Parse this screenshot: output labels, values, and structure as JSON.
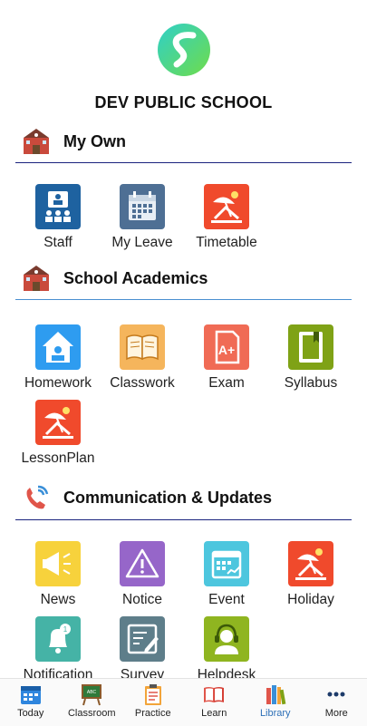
{
  "school": {
    "name": "DEV PUBLIC SCHOOL"
  },
  "sections": [
    {
      "title": "My Own",
      "icon": "school-building-icon",
      "items": [
        {
          "label": "Staff",
          "icon": "staff-icon",
          "color": "#1e62a0"
        },
        {
          "label": "My Leave",
          "icon": "calendar-icon",
          "color": "#4e6f94"
        },
        {
          "label": "Timetable",
          "icon": "beach-chair-icon",
          "color": "#f04a2c"
        }
      ]
    },
    {
      "title": "School Academics",
      "icon": "school-building-icon",
      "items": [
        {
          "label": "Homework",
          "icon": "home-study-icon",
          "color": "#2e9cf0"
        },
        {
          "label": "Classwork",
          "icon": "open-book-icon",
          "color": "#f5b55c"
        },
        {
          "label": "Exam",
          "icon": "grade-paper-icon",
          "color": "#f06b55"
        },
        {
          "label": "Syllabus",
          "icon": "book-icon",
          "color": "#7fa216"
        },
        {
          "label": "LessonPlan",
          "icon": "beach-chair-icon",
          "color": "#f04a2c"
        }
      ]
    },
    {
      "title": "Communication & Updates",
      "icon": "telephone-icon",
      "items": [
        {
          "label": "News",
          "icon": "megaphone-icon",
          "color": "#f7d23c"
        },
        {
          "label": "Notice",
          "icon": "warning-icon",
          "color": "#9666c9"
        },
        {
          "label": "Event",
          "icon": "event-calendar-icon",
          "color": "#4dc6de"
        },
        {
          "label": "Holiday",
          "icon": "beach-chair-icon",
          "color": "#f04a2c"
        },
        {
          "label": "Notification",
          "icon": "bell-icon",
          "color": "#45b3a6"
        },
        {
          "label": "Survey",
          "icon": "survey-icon",
          "color": "#5e7e8a"
        },
        {
          "label": "Helpdesk",
          "icon": "headset-icon",
          "color": "#8fb520"
        }
      ]
    }
  ],
  "bottom_nav": [
    {
      "label": "Today",
      "icon": "calendar-icon"
    },
    {
      "label": "Classroom",
      "icon": "chalkboard-icon"
    },
    {
      "label": "Practice",
      "icon": "clipboard-icon"
    },
    {
      "label": "Learn",
      "icon": "open-book-icon"
    },
    {
      "label": "Library",
      "icon": "books-icon",
      "active": true
    },
    {
      "label": "More",
      "icon": "more-dots-icon"
    }
  ],
  "colors": {
    "accent_blue": "#2c6fb7",
    "rule_dark": "#1a237e",
    "rule_light": "#4a8fd0"
  }
}
